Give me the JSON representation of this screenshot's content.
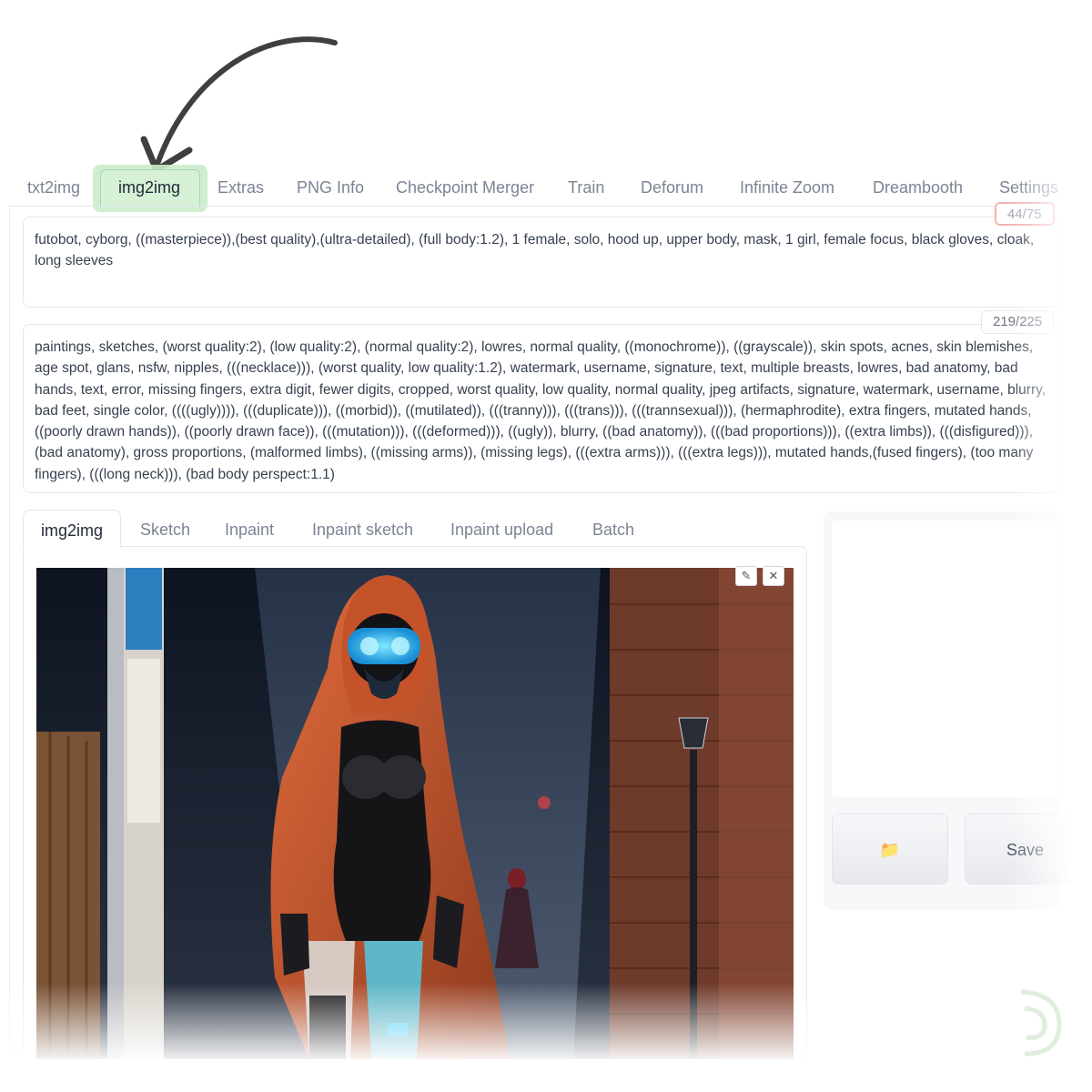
{
  "top_tabs": {
    "items": [
      {
        "label": "txt2img"
      },
      {
        "label": "img2img",
        "active": true
      },
      {
        "label": "Extras"
      },
      {
        "label": "PNG Info"
      },
      {
        "label": "Checkpoint Merger"
      },
      {
        "label": "Train"
      },
      {
        "label": "Deforum"
      },
      {
        "label": "Infinite Zoom"
      },
      {
        "label": "Dreambooth"
      },
      {
        "label": "Settings"
      }
    ],
    "highlight_color": "#c9ecca"
  },
  "prompt": {
    "text": "futobot, cyborg, ((masterpiece)),(best quality),(ultra-detailed), (full body:1.2), 1 female, solo, hood up, upper body, mask, 1 girl, female focus, black gloves, cloak, long sleeves",
    "token_count": "44/75"
  },
  "negative_prompt": {
    "text": "paintings, sketches, (worst quality:2), (low quality:2), (normal quality:2), lowres, normal quality, ((monochrome)), ((grayscale)), skin spots, acnes, skin blemishes, age spot, glans, nsfw, nipples, (((necklace))), (worst quality, low quality:1.2), watermark, username, signature, text, multiple breasts, lowres, bad anatomy, bad hands, text, error, missing fingers, extra digit, fewer digits, cropped, worst quality, low quality, normal quality, jpeg artifacts, signature, watermark, username, blurry, bad feet, single color, ((((ugly)))), (((duplicate))), ((morbid)), ((mutilated)), (((tranny))), (((trans))), (((trannsexual))), (hermaphrodite), extra fingers, mutated hands, ((poorly drawn hands)), ((poorly drawn face)), (((mutation))), (((deformed))), ((ugly)), blurry, ((bad anatomy)), (((bad proportions))), ((extra limbs)), (((disfigured))), (bad anatomy), gross proportions, (malformed limbs), ((missing arms)), (missing legs), (((extra arms))), (((extra legs))), mutated hands,(fused fingers), (too many fingers), (((long neck))), (bad body perspect:1.1)",
    "token_count": "219/225"
  },
  "sub_tabs": {
    "items": [
      {
        "label": "img2img",
        "active": true
      },
      {
        "label": "Sketch"
      },
      {
        "label": "Inpaint"
      },
      {
        "label": "Inpaint sketch"
      },
      {
        "label": "Inpaint upload"
      },
      {
        "label": "Batch"
      }
    ]
  },
  "image_controls": {
    "edit_icon": "pencil-icon",
    "close_icon": "close-icon",
    "edit_glyph": "✎",
    "close_glyph": "✕"
  },
  "output": {
    "folder_icon": "folder-icon",
    "folder_glyph": "📁",
    "save_label": "Save"
  }
}
